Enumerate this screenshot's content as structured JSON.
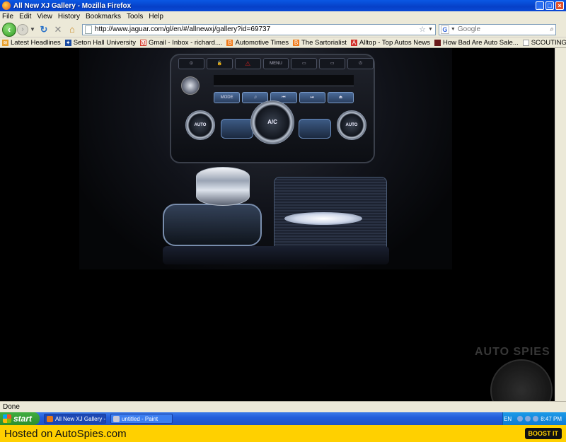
{
  "window": {
    "title": "All New XJ Gallery - Mozilla Firefox",
    "controls": {
      "minimize": "_",
      "maximize": "□",
      "close": "×"
    }
  },
  "menu": {
    "items": [
      "File",
      "Edit",
      "View",
      "History",
      "Bookmarks",
      "Tools",
      "Help"
    ]
  },
  "nav": {
    "back": "‹",
    "forward": "›",
    "reload": "↻",
    "stop": "✕",
    "home": "⌂",
    "url": "http://www.jaguar.com/gl/en/#/allnewxj/gallery?id=69737",
    "search_placeholder": "Google"
  },
  "bookmarks": [
    {
      "label": "Latest Headlines",
      "icon": "rss-icon",
      "color": "#e8a02a"
    },
    {
      "label": "Seton Hall University",
      "icon": "shu-icon",
      "color": "#1a4aa0"
    },
    {
      "label": "Gmail - Inbox - richard....",
      "icon": "gmail-icon",
      "color": "#d23a2a"
    },
    {
      "label": "Automotive Times",
      "icon": "blogger-icon",
      "color": "#f07a1a"
    },
    {
      "label": "The Sartorialist",
      "icon": "blogger-icon",
      "color": "#f07a1a"
    },
    {
      "label": "Alltop - Top Autos News",
      "icon": "alltop-icon",
      "color": "#d0302a"
    },
    {
      "label": "How Bad Are Auto Sale...",
      "icon": "site-icon",
      "color": "#6a1a1a"
    },
    {
      "label": "SCOUTING NY - www.s...",
      "icon": "page-icon",
      "color": "#ffffff"
    }
  ],
  "console": {
    "top_buttons": [
      "⊙",
      "🔓",
      "⚠",
      "MENU",
      "▭",
      "▭",
      "⏻"
    ],
    "media_buttons": [
      "MODE",
      "♫",
      "⏮",
      "⏭",
      "⏏"
    ],
    "dial_left": "AUTO",
    "dial_center": "A/C",
    "dial_right": "AUTO"
  },
  "watermark": {
    "text": "AUTO SPIES"
  },
  "status": {
    "text": "Done"
  },
  "taskbar": {
    "start_label": "start",
    "tasks": [
      {
        "label": "All New XJ Gallery - M...",
        "active": true
      },
      {
        "label": "untitled - Paint",
        "active": false
      }
    ],
    "tray": {
      "lang": "EN",
      "time": "8:47 PM"
    }
  },
  "footer": {
    "hosted_text": "Hosted on AutoSpies.com",
    "boost_label": "BOOST IT"
  },
  "colors": {
    "titlebar_blue": "#0640c8",
    "xp_gray": "#ece9d8",
    "footer_yellow": "#ffd000",
    "start_green": "#2e8f2e"
  }
}
